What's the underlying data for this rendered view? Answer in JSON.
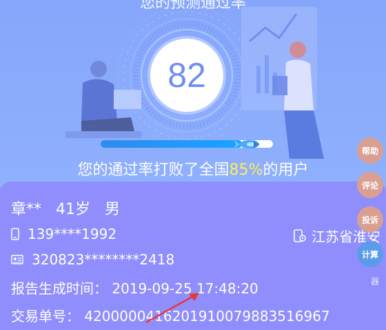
{
  "hero": {
    "title": "您的预测通过率",
    "score": "82",
    "progress_fraction": 0.82,
    "beat_prefix": "您的通过率打败了全国",
    "beat_percent": "85%",
    "beat_suffix": "的用户"
  },
  "user": {
    "name": "章**",
    "age": "41岁",
    "gender": "男",
    "phone": "139****1992",
    "location": "江苏省淮安",
    "id_number": "320823********2418",
    "report_time_label": "报告生成时间：",
    "report_time": "2019-09-25 17:48:20",
    "order_label": "交易单号：",
    "order_number": "4200000416201910079883516967"
  },
  "side_menu": {
    "help": "帮助",
    "comment": "评论",
    "complaint": "投诉",
    "calculator": "计算",
    "calculator_suffix": "器"
  },
  "colors": {
    "accent_yellow": "#ffee58",
    "progress_blue": "#1e9af5",
    "card_purple": "#8f8efc",
    "hero_blue": "#86a6fb"
  },
  "icons": {
    "phone": "phone-icon",
    "location": "location-icon",
    "id_card": "id-card-icon",
    "rocket": "rocket-icon"
  }
}
